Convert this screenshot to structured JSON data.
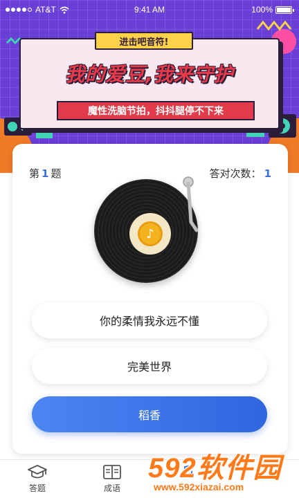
{
  "status_bar": {
    "carrier": "AT&T",
    "time": "9:41 AM",
    "battery": "100%"
  },
  "banner": {
    "tag": "进击吧音符!",
    "headline": "我的爱豆,我来守护",
    "subhead": "魔性洗脑节拍，抖抖腿停不下来"
  },
  "quiz": {
    "question_prefix": "第",
    "question_number": "1",
    "question_suffix": "题",
    "score_label": "答对次数：",
    "score_value": "1",
    "options": [
      {
        "label": "你的柔情我永远不懂",
        "selected": false
      },
      {
        "label": "完美世界",
        "selected": false
      },
      {
        "label": "稻香",
        "selected": true
      }
    ]
  },
  "nav": {
    "items": [
      {
        "label": "答题",
        "icon": "graduation-cap-icon"
      },
      {
        "label": "成语",
        "icon": "book-icon"
      },
      {
        "label": "",
        "icon": "music-icon"
      },
      {
        "label": "",
        "icon": "user-icon"
      }
    ]
  },
  "watermark": {
    "logo_text": "592软件园",
    "url": "www.592xiazai.com"
  },
  "colors": {
    "banner_purple": "#6a3fd6",
    "accent_blue": "#3a6fe0",
    "headline_red": "#e93a4a",
    "tag_yellow": "#ffd24a"
  }
}
